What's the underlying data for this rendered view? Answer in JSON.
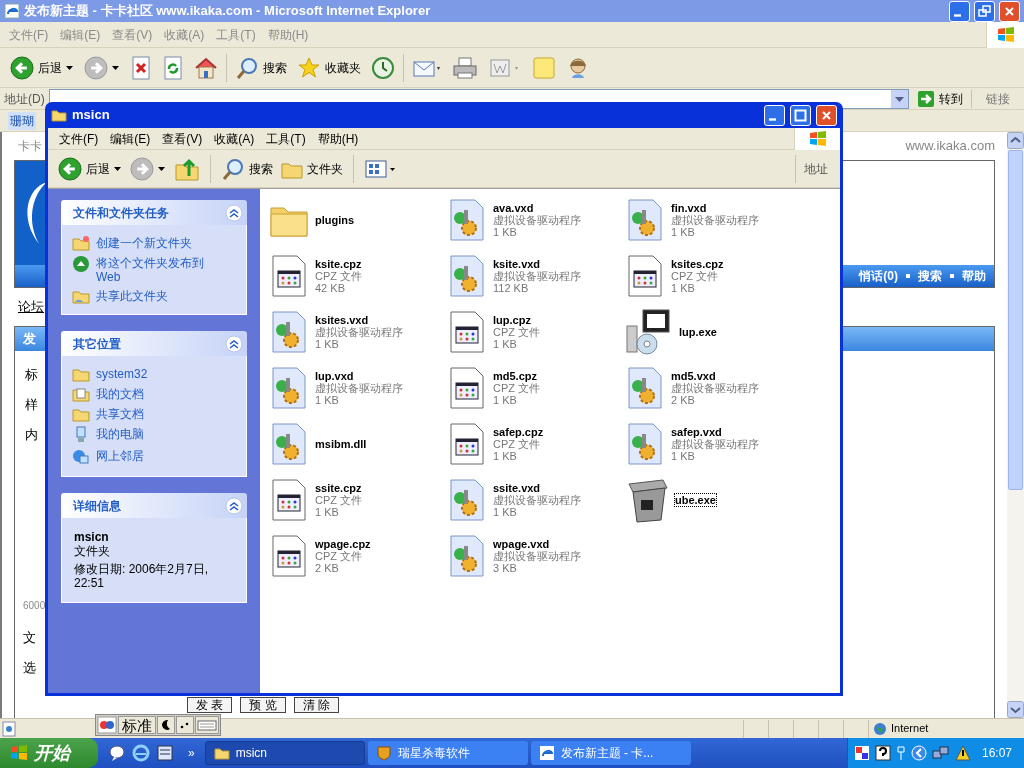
{
  "ie_window": {
    "title": "发布新主题 - 卡卡社区 www.ikaka.com - Microsoft Internet Explorer",
    "menu": [
      "文件(F)",
      "编辑(E)",
      "查看(V)",
      "收藏(A)",
      "工具(T)",
      "帮助(H)"
    ],
    "toolbar": [
      {
        "kind": "back",
        "label": "后退"
      },
      {
        "kind": "forward"
      },
      {
        "kind": "stop"
      },
      {
        "kind": "refresh"
      },
      {
        "kind": "home"
      },
      {
        "kind": "search",
        "label": "搜索"
      },
      {
        "kind": "favorites",
        "label": "收藏夹"
      },
      {
        "kind": "media"
      },
      {
        "kind": "mail"
      },
      {
        "kind": "print"
      },
      {
        "kind": "edit"
      },
      {
        "kind": "note"
      },
      {
        "kind": "messenger"
      }
    ],
    "address_label": "地址(D)",
    "go_label": "转到",
    "links_label": "链接",
    "links_bar_item": "珊瑚",
    "status_zone": "Internet"
  },
  "web_page": {
    "site_name": "卡卡",
    "site_url": "www.ikaka.com",
    "nav_links": [
      "悄话(0)",
      "搜索",
      "帮助"
    ],
    "breadcrumb": "论坛",
    "panel_title": "发",
    "form_labels": [
      "标",
      "样",
      "内"
    ],
    "char_limit": "6000",
    "form_labels_lower": [
      "文",
      "选"
    ],
    "buttons": [
      "发 表",
      "预 览",
      "清 除"
    ]
  },
  "explorer": {
    "title": "msicn",
    "menu": [
      "文件(F)",
      "编辑(E)",
      "查看(V)",
      "收藏(A)",
      "工具(T)",
      "帮助(H)"
    ],
    "toolbar": [
      {
        "kind": "back",
        "label": "后退"
      },
      {
        "kind": "forward"
      },
      {
        "kind": "up"
      },
      {
        "kind": "search",
        "label": "搜索"
      },
      {
        "kind": "folders",
        "label": "文件夹"
      },
      {
        "kind": "views"
      }
    ],
    "address_label": "地址",
    "task_panels": [
      {
        "title": "文件和文件夹任务",
        "expanded": true,
        "items": [
          {
            "label": "创建一个新文件夹"
          },
          {
            "label": "将这个文件夹发布到 Web"
          },
          {
            "label": "共享此文件夹"
          }
        ]
      },
      {
        "title": "其它位置",
        "expanded": true,
        "items": [
          {
            "label": "system32"
          },
          {
            "label": "我的文档"
          },
          {
            "label": "共享文档"
          },
          {
            "label": "我的电脑"
          },
          {
            "label": "网上邻居"
          }
        ]
      }
    ],
    "details": {
      "title": "详细信息",
      "expanded": true,
      "name": "msicn",
      "type": "文件夹",
      "modified": "修改日期: 2006年2月7日, 22:51"
    },
    "files": [
      {
        "kind": "folder",
        "name": "plugins",
        "focused": false
      },
      {
        "kind": "vxd",
        "name": "ava.vxd",
        "type": "虚拟设备驱动程序",
        "size": "1 KB",
        "focused": false
      },
      {
        "kind": "vxd",
        "name": "fin.vxd",
        "type": "虚拟设备驱动程序",
        "size": "1 KB",
        "focused": false
      },
      {
        "kind": "cpz",
        "name": "ksite.cpz",
        "type": "CPZ 文件",
        "size": "42 KB",
        "focused": false
      },
      {
        "kind": "vxd",
        "name": "ksite.vxd",
        "type": "虚拟设备驱动程序",
        "size": "112 KB",
        "focused": false
      },
      {
        "kind": "cpz",
        "name": "ksites.cpz",
        "type": "CPZ 文件",
        "size": "1 KB",
        "focused": false
      },
      {
        "kind": "vxd",
        "name": "ksites.vxd",
        "type": "虚拟设备驱动程序",
        "size": "1 KB",
        "focused": false
      },
      {
        "kind": "cpz",
        "name": "lup.cpz",
        "type": "CPZ 文件",
        "size": "1 KB",
        "focused": false
      },
      {
        "kind": "setup",
        "name": "lup.exe",
        "focused": false
      },
      {
        "kind": "vxd",
        "name": "lup.vxd",
        "type": "虚拟设备驱动程序",
        "size": "1 KB",
        "focused": false
      },
      {
        "kind": "cpz",
        "name": "md5.cpz",
        "type": "CPZ 文件",
        "size": "1 KB",
        "focused": false
      },
      {
        "kind": "vxd",
        "name": "md5.vxd",
        "type": "虚拟设备驱动程序",
        "size": "2 KB",
        "focused": false
      },
      {
        "kind": "vxd",
        "name": "msibm.dll",
        "focused": false
      },
      {
        "kind": "cpz",
        "name": "safep.cpz",
        "type": "CPZ 文件",
        "size": "1 KB",
        "focused": false
      },
      {
        "kind": "vxd",
        "name": "safep.vxd",
        "type": "虚拟设备驱动程序",
        "size": "1 KB",
        "focused": false
      },
      {
        "kind": "cpz",
        "name": "ssite.cpz",
        "type": "CPZ 文件",
        "size": "1 KB",
        "focused": false
      },
      {
        "kind": "vxd",
        "name": "ssite.vxd",
        "type": "虚拟设备驱动程序",
        "size": "1 KB",
        "focused": false
      },
      {
        "kind": "bin",
        "name": "ube.exe",
        "focused": true
      },
      {
        "kind": "cpz",
        "name": "wpage.cpz",
        "type": "CPZ 文件",
        "size": "2 KB",
        "focused": false
      },
      {
        "kind": "vxd",
        "name": "wpage.vxd",
        "type": "虚拟设备驱动程序",
        "size": "3 KB",
        "focused": false
      }
    ]
  },
  "ime_bar": {
    "mode": "标准"
  },
  "taskbar": {
    "start_label": "开始",
    "overflow": "»",
    "tasks": [
      {
        "label": "msicn",
        "selected": true
      },
      {
        "label": "瑞星杀毒软件",
        "selected": false
      },
      {
        "label": "发布新主题 - 卡...",
        "selected": false
      }
    ],
    "clock": "16:07"
  }
}
